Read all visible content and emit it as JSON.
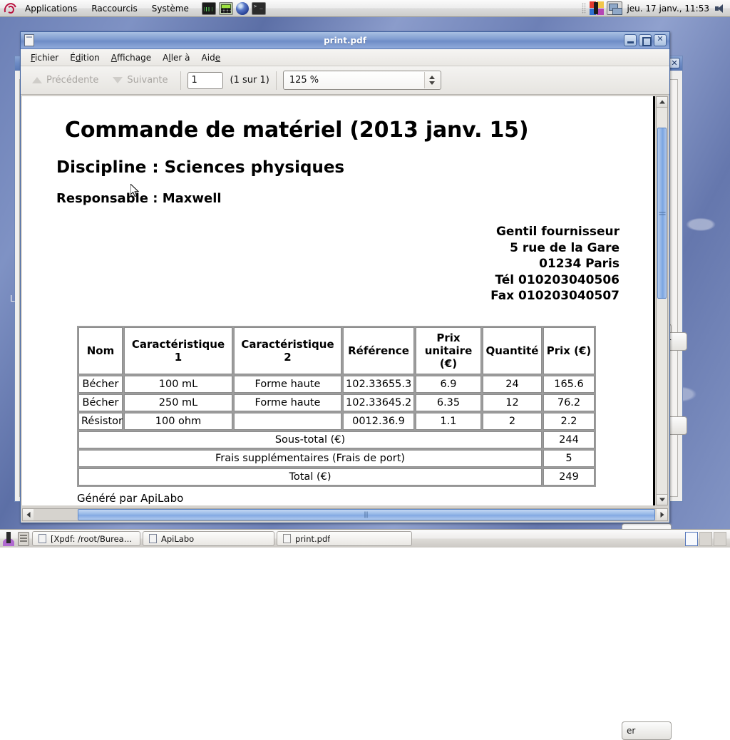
{
  "top_panel": {
    "logo": "debian-logo",
    "menus": [
      "Applications",
      "Raccourcis",
      "Système"
    ],
    "launchers": [
      {
        "name": "system-monitor-icon"
      },
      {
        "name": "calculator-icon"
      },
      {
        "name": "web-browser-icon"
      },
      {
        "name": "terminal-icon"
      }
    ],
    "clock": "jeu. 17 janv., 11:53",
    "tray": [
      {
        "name": "office-suite-tray-icon"
      },
      {
        "name": "network-tray-icon"
      },
      {
        "name": "volume-tray-icon"
      }
    ]
  },
  "background_window": {
    "name": "ApiLabo",
    "close_label": "✕",
    "left_edge_text": "Li",
    "buttons": [
      {
        "label": ""
      },
      {
        "label": ""
      },
      {
        "label": "er"
      },
      {
        "label": "r"
      }
    ]
  },
  "window": {
    "title": "print.pdf",
    "minimize_label": "–",
    "maximize_label": "□",
    "close_label": "✕",
    "menus": [
      {
        "pre": "",
        "acc": "F",
        "post": "ichier"
      },
      {
        "pre": "É",
        "acc": "d",
        "post": "ition"
      },
      {
        "pre": "",
        "acc": "A",
        "post": "ffichage"
      },
      {
        "pre": "A",
        "acc": "l",
        "post": "ler à"
      },
      {
        "pre": "Aid",
        "acc": "e",
        "post": ""
      }
    ],
    "toolbar": {
      "prev_label": "Précédente",
      "next_label": "Suivante",
      "page_value": "1",
      "page_count": "(1 sur 1)",
      "zoom_value": "125 %"
    }
  },
  "document": {
    "title": "Commande de matériel (2013 janv. 15)",
    "discipline": "Discipline : Sciences physiques",
    "responsable": "Responsable : Maxwell",
    "supplier": [
      "Gentil fournisseur",
      "5 rue de la Gare",
      "01234 Paris",
      "Tél 010203040506",
      "Fax 010203040507"
    ],
    "table": {
      "headers": [
        "Nom",
        "Caractéristique 1",
        "Caractéristique 2",
        "Référence",
        "Prix unitaire (€)",
        "Quantité",
        "Prix (€)"
      ],
      "rows": [
        [
          "Bécher",
          "100 mL",
          "Forme haute",
          "102.33655.3",
          "6.9",
          "24",
          "165.6"
        ],
        [
          "Bécher",
          "250 mL",
          "Forme haute",
          "102.33645.2",
          "6.35",
          "12",
          "76.2"
        ],
        [
          "Résistor",
          "100 ohm",
          "",
          "0012.36.9",
          "1.1",
          "2",
          "2.2"
        ]
      ],
      "summary": [
        {
          "label": "Sous-total (€)",
          "value": "244",
          "bold": true
        },
        {
          "label": "Frais supplémentaires (Frais de port)",
          "value": "5",
          "bold": false
        },
        {
          "label": "Total (€)",
          "value": "249",
          "bold": true
        }
      ]
    },
    "footer": "Généré par ApiLabo"
  },
  "taskbar": {
    "tasks": [
      {
        "label": "[Xpdf: /root/Bureau/L...",
        "icon": "window-icon"
      },
      {
        "label": "ApiLabo",
        "icon": "window-icon"
      },
      {
        "label": "print.pdf",
        "icon": "document-icon"
      }
    ]
  },
  "colors": {
    "titlebar_blue": "#7e9bd0",
    "desktop_blue": "#7184ba",
    "scroll_thumb": "#8fb3e6"
  }
}
